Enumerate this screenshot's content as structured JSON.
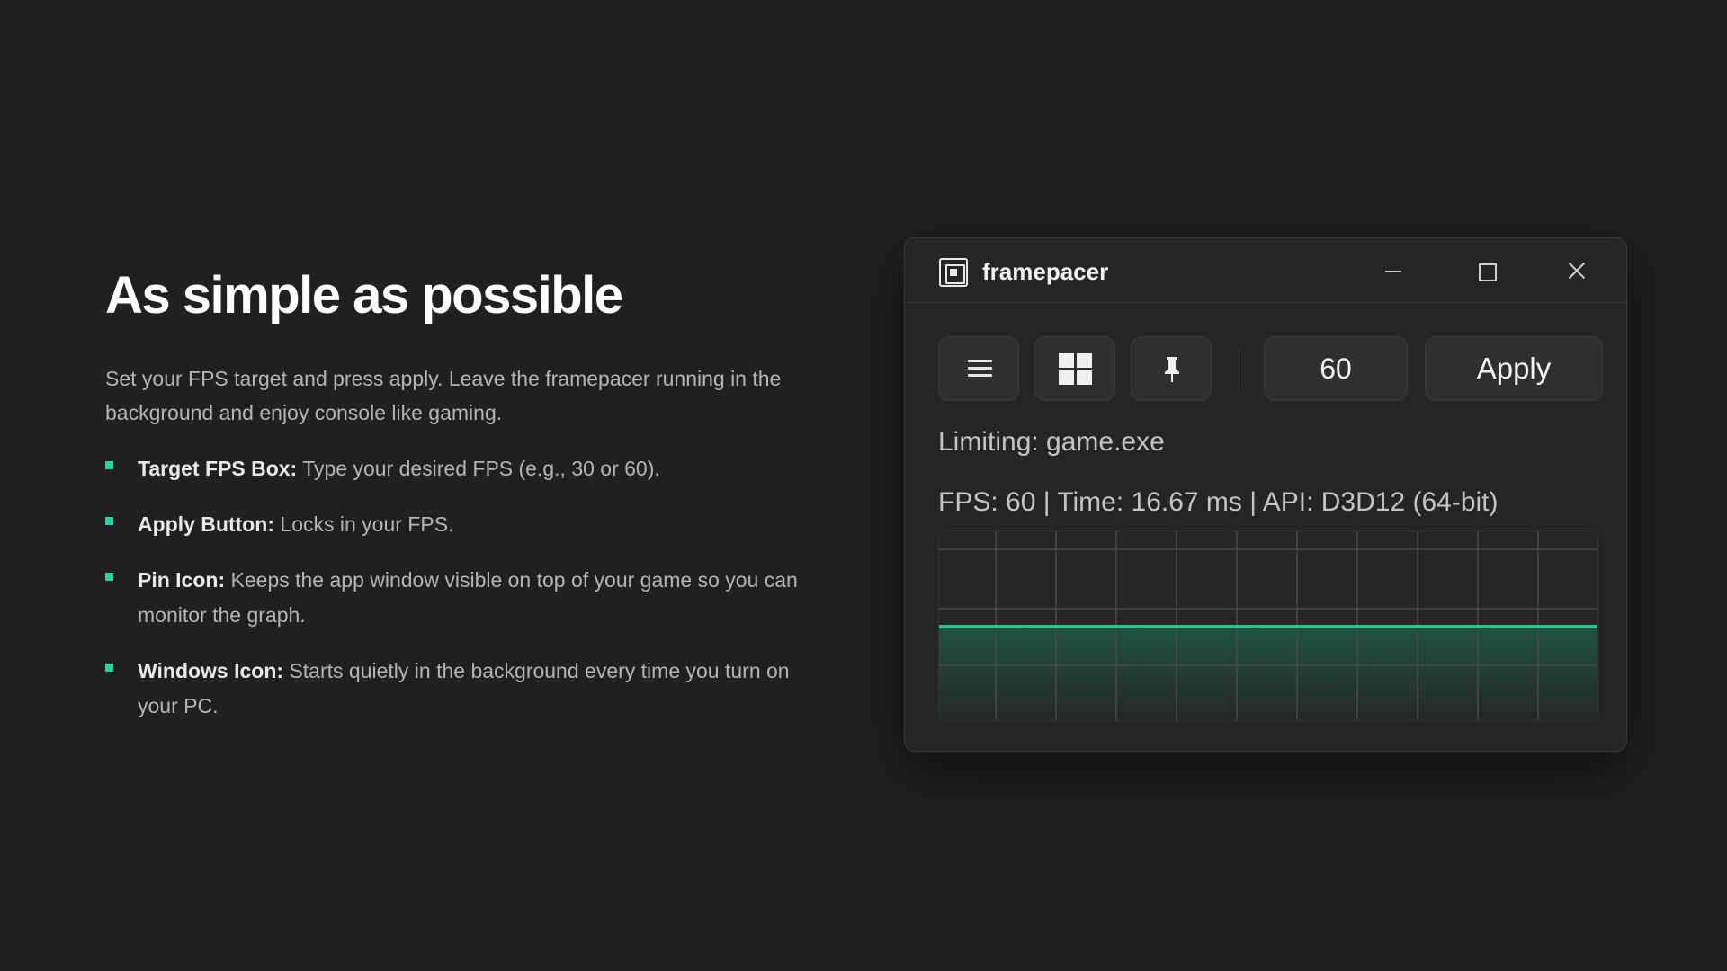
{
  "hero": {
    "title": "As simple as possible",
    "lead": "Set your FPS target and press apply. Leave the framepacer running in the background and enjoy console like gaming.",
    "features": [
      {
        "term": "Target FPS Box:",
        "desc": " Type your desired FPS (e.g., 30 or 60)."
      },
      {
        "term": "Apply Button:",
        "desc": " Locks in your FPS."
      },
      {
        "term": "Pin Icon:",
        "desc": " Keeps the app window visible on top of your game so you can monitor the graph."
      },
      {
        "term": "Windows Icon:",
        "desc": " Starts quietly in the background every time you turn on your PC."
      }
    ]
  },
  "window": {
    "title": "framepacer",
    "fps_value": "60",
    "apply_label": "Apply",
    "limiting": "Limiting: game.exe",
    "stats": "FPS: 60 | Time: 16.67 ms | API: D3D12 (64-bit)"
  },
  "colors": {
    "accent": "#1ed9a0",
    "line": "#27c48f",
    "background": "#202020"
  },
  "graph": {
    "frame_time_ms": 16.67
  }
}
